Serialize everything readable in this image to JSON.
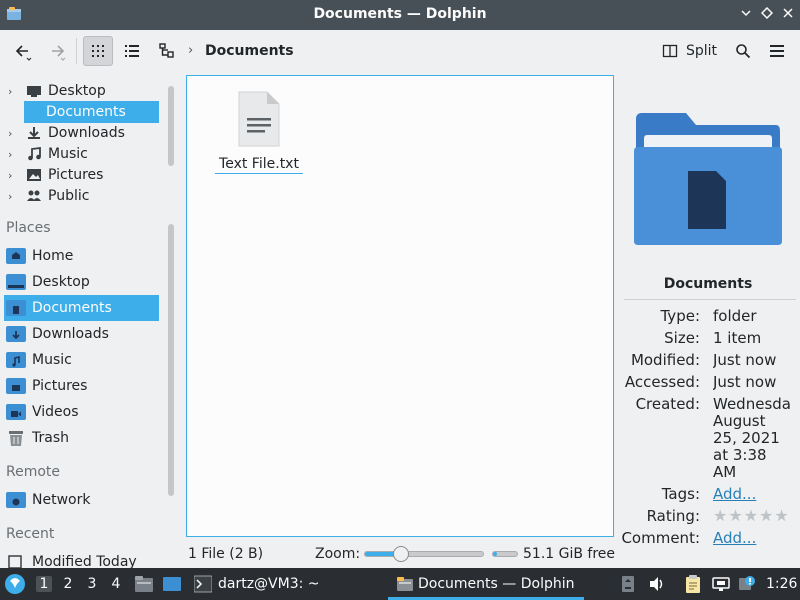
{
  "window": {
    "title": "Documents — Dolphin"
  },
  "toolbar": {
    "breadcrumb": "Documents",
    "split_label": "Split"
  },
  "folder_tree": [
    {
      "label": "Desktop",
      "icon": "desktop-icon"
    },
    {
      "label": "Documents",
      "icon": "folder-documents-icon",
      "selected": true
    },
    {
      "label": "Downloads",
      "icon": "download-icon"
    },
    {
      "label": "Music",
      "icon": "music-icon"
    },
    {
      "label": "Pictures",
      "icon": "pictures-icon"
    },
    {
      "label": "Public",
      "icon": "public-icon"
    }
  ],
  "places": {
    "header": "Places",
    "items": [
      {
        "label": "Home",
        "icon": "folder-home-icon"
      },
      {
        "label": "Desktop",
        "icon": "desktop-icon"
      },
      {
        "label": "Documents",
        "icon": "folder-documents-icon",
        "selected": true
      },
      {
        "label": "Downloads",
        "icon": "folder-downloads-icon"
      },
      {
        "label": "Music",
        "icon": "folder-music-icon"
      },
      {
        "label": "Pictures",
        "icon": "folder-pictures-icon"
      },
      {
        "label": "Videos",
        "icon": "folder-videos-icon"
      },
      {
        "label": "Trash",
        "icon": "trash-icon"
      }
    ]
  },
  "remote": {
    "header": "Remote",
    "items": [
      {
        "label": "Network",
        "icon": "network-icon"
      }
    ]
  },
  "recent": {
    "header": "Recent",
    "items": [
      {
        "label": "Modified Today",
        "icon": "checkbox-icon"
      }
    ]
  },
  "files": [
    {
      "name": "Text File.txt",
      "icon": "text-file-icon"
    }
  ],
  "info_panel": {
    "title": "Documents",
    "rows": [
      {
        "key": "Type:",
        "value": "folder"
      },
      {
        "key": "Size:",
        "value": "1 item"
      },
      {
        "key": "Modified:",
        "value": "Just now"
      },
      {
        "key": "Accessed:",
        "value": "Just now"
      },
      {
        "key": "Created:",
        "value": "Wednesda August 25, 2021 at 3:38 AM"
      }
    ],
    "tags_label": "Tags:",
    "tags_link": "Add...",
    "rating_label": "Rating:",
    "rating": 0,
    "comment_label": "Comment:",
    "comment_link": "Add..."
  },
  "statusbar": {
    "file_count": "1 File (2 B)",
    "zoom_label": "Zoom:",
    "zoom_level": 0.27,
    "free_space_fraction": 0.15,
    "free_space": "51.1 GiB free"
  },
  "taskbar": {
    "desktops": [
      "1",
      "2",
      "3",
      "4"
    ],
    "active_desktop": "1",
    "tasks": [
      {
        "label": "dartz@VM3: ~",
        "icon": "terminal-icon"
      },
      {
        "label": "Documents — Dolphin",
        "icon": "dolphin-icon",
        "active": true
      }
    ],
    "clock": "1:26"
  },
  "colors": {
    "accent": "#3daee9",
    "folder_blue": "#4a90d9",
    "titlebar": "#475057",
    "taskbar": "#2a2e32"
  }
}
